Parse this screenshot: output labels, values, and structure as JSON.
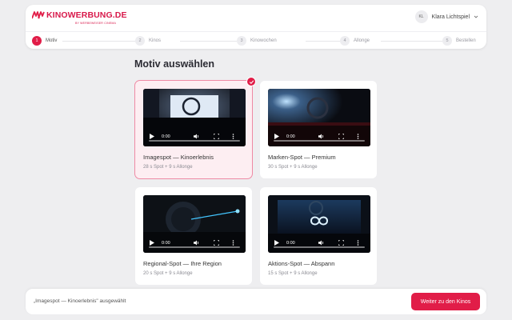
{
  "brand": {
    "name": "KINOWERBUNG.DE",
    "tagline": "BY WERBEWEISER CINEMA",
    "accent_color": "#e11d48"
  },
  "user": {
    "initials": "KL",
    "name": "Klara Lichtspiel",
    "menu_icon": "chevron-down-icon"
  },
  "steps": [
    {
      "number": "1",
      "label": "Motiv",
      "active": true
    },
    {
      "number": "2",
      "label": "Kinos",
      "active": false
    },
    {
      "number": "3",
      "label": "Kinowochen",
      "active": false
    },
    {
      "number": "4",
      "label": "Allonge",
      "active": false
    },
    {
      "number": "5",
      "label": "Bestellen",
      "active": false
    }
  ],
  "main": {
    "title": "Motiv auswählen"
  },
  "motifs": [
    {
      "title": "Imagespot — Kinoerlebnis",
      "meta": "28 s Spot + 9 s Allonge",
      "time": "0:00",
      "selected": true,
      "progress": 0
    },
    {
      "title": "Marken-Spot — Premium",
      "meta": "30 s Spot + 9 s Allonge",
      "time": "0:00",
      "selected": false,
      "progress": 0
    },
    {
      "title": "Regional-Spot — Ihre Region",
      "meta": "20 s Spot + 9 s Allonge",
      "time": "0:00",
      "selected": false,
      "progress": 0
    },
    {
      "title": "Aktions-Spot — Abspann",
      "meta": "15 s Spot + 9 s Allonge",
      "time": "0:00",
      "selected": false,
      "progress": 0
    }
  ],
  "footer": {
    "selection_text": "„Imagespot — Kinoerlebnis\" ausgewählt",
    "next_label": "Weiter zu den Kinos"
  }
}
